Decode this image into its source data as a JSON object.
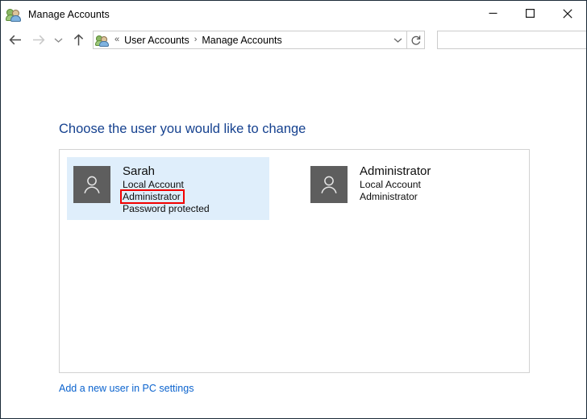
{
  "window": {
    "title": "Manage Accounts",
    "title_icon": "users-icon",
    "controls": {
      "minimize": "Minimize",
      "maximize": "Maximize",
      "close": "Close"
    }
  },
  "navbar": {
    "back": "Back",
    "forward": "Forward",
    "recent": "Recent locations",
    "up": "Up one level",
    "breadcrumb": {
      "icon": "users-icon",
      "overflow": "«",
      "separator": "›",
      "items": [
        {
          "label": "User Accounts"
        },
        {
          "label": "Manage Accounts"
        }
      ],
      "dropdown": "chevron-down-icon"
    },
    "refresh": "Refresh",
    "search": {
      "value": "",
      "placeholder": "",
      "icon": "search-icon"
    }
  },
  "main": {
    "heading": "Choose the user you would like to change",
    "accounts": [
      {
        "name": "Sarah",
        "account_type": "Local Account",
        "role": "Administrator",
        "password_status": "Password protected",
        "selected": true,
        "avatar_icon": "person-icon",
        "highlighted_line": "role"
      },
      {
        "name": "Administrator",
        "account_type": "Local Account",
        "role": "Administrator",
        "password_status": "",
        "selected": false,
        "avatar_icon": "person-icon",
        "highlighted_line": ""
      }
    ],
    "add_user_link": "Add a new user in PC settings"
  },
  "colors": {
    "heading_blue": "#15418f",
    "link_blue": "#0b63ce",
    "selection_blue": "#dfeefb",
    "avatar_gray": "#5e5e5e",
    "annotation_red": "#f20000",
    "panel_border": "#d2d2d2"
  }
}
